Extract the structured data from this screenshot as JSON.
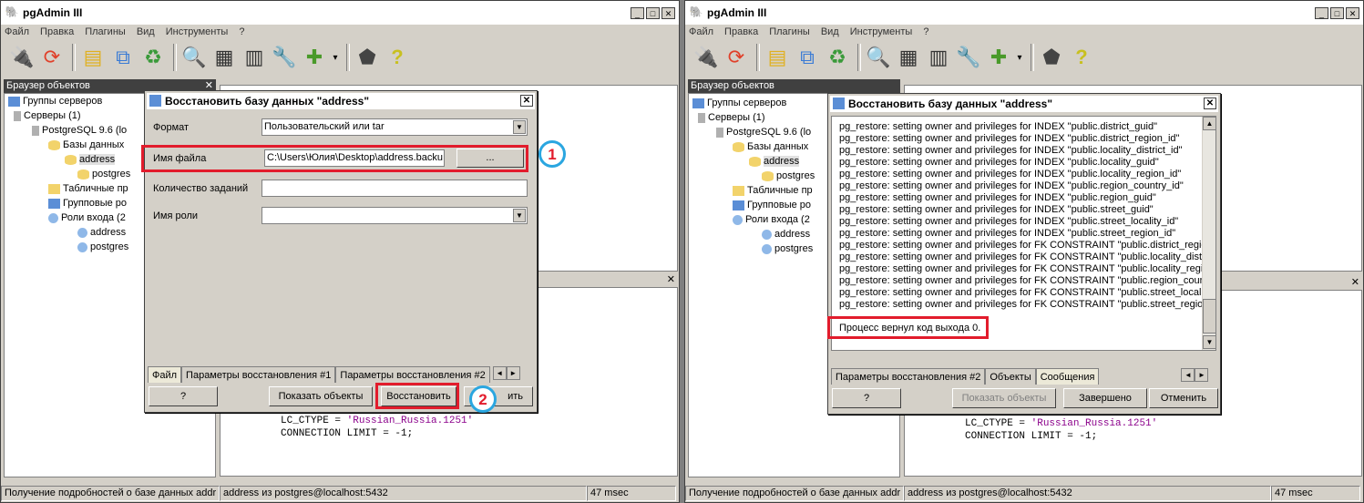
{
  "app_title": "pgAdmin III",
  "menu": [
    "Файл",
    "Правка",
    "Плагины",
    "Вид",
    "Инструменты",
    "?"
  ],
  "browser_title": "Браузер объектов",
  "tree": {
    "groups": "Группы серверов",
    "servers": "Серверы (1)",
    "server": "PostgreSQL 9.6 (lo",
    "databases": "Базы данных",
    "db_address": "address",
    "db_postgres": "postgres",
    "tablespaces_left": "Табличные пр",
    "group_roles_left": "Групповые ро",
    "login_roles_left": "Роли входа (2",
    "tablespaces_right": "Табличные пр",
    "group_roles_right": "Групповые ро",
    "login_roles_right": "Роли входа (2",
    "role_address": "address",
    "role_postgres": "postgres"
  },
  "sql": {
    "line1_key": "LC_CTYPE = ",
    "line1_val": "'Russian_Russia.1251'",
    "line2": "CONNECTION LIMIT = -1;"
  },
  "status": {
    "left": "Получение подробностей о базе данных addr",
    "mid": "address из postgres@localhost:5432",
    "right": "47 msec"
  },
  "dialog_left": {
    "title": "Восстановить базу данных \"address\"",
    "format_label": "Формат",
    "format_value": "Пользовательский или tar",
    "filename_label": "Имя файла",
    "filename_value": "C:\\Users\\Юлия\\Desktop\\address.backu",
    "browse_label": "...",
    "jobs_label": "Количество заданий",
    "role_label": "Имя роли",
    "tabs": [
      "Файл",
      "Параметры восстановления #1",
      "Параметры восстановления #2"
    ],
    "help_btn": "?",
    "show_objects_btn": "Показать объекты",
    "restore_btn": "Восстановить",
    "cancel_btn": "ить"
  },
  "badges": {
    "one": "1",
    "two": "2"
  },
  "dialog_right": {
    "title": "Восстановить базу данных \"address\"",
    "log": [
      "pg_restore: setting owner and privileges for INDEX \"public.district_guid\"",
      "pg_restore: setting owner and privileges for INDEX \"public.district_region_id\"",
      "pg_restore: setting owner and privileges for INDEX \"public.locality_district_id\"",
      "pg_restore: setting owner and privileges for INDEX \"public.locality_guid\"",
      "pg_restore: setting owner and privileges for INDEX \"public.locality_region_id\"",
      "pg_restore: setting owner and privileges for INDEX \"public.region_country_id\"",
      "pg_restore: setting owner and privileges for INDEX \"public.region_guid\"",
      "pg_restore: setting owner and privileges for INDEX \"public.street_guid\"",
      "pg_restore: setting owner and privileges for INDEX \"public.street_locality_id\"",
      "pg_restore: setting owner and privileges for INDEX \"public.street_region_id\"",
      "pg_restore: setting owner and privileges for FK CONSTRAINT \"public.district_region",
      "pg_restore: setting owner and privileges for FK CONSTRAINT \"public.locality_distric",
      "pg_restore: setting owner and privileges for FK CONSTRAINT \"public.locality_regio",
      "pg_restore: setting owner and privileges for FK CONSTRAINT \"public.region_countr",
      "pg_restore: setting owner and privileges for FK CONSTRAINT \"public.street_locality",
      "pg_restore: setting owner and privileges for FK CONSTRAINT \"public.street_region"
    ],
    "exit_message": "Процесс вернул код выхода 0.",
    "tabs": [
      "Параметры восстановления #2",
      "Объекты",
      "Сообщения"
    ],
    "help_btn": "?",
    "show_objects_btn": "Показать объекты",
    "done_btn": "Завершено",
    "cancel_btn": "Отменить"
  },
  "colors": {
    "highlight": "#e21c2c",
    "badge_ring": "#2aa6e0",
    "sql_string": "#8b008b"
  }
}
